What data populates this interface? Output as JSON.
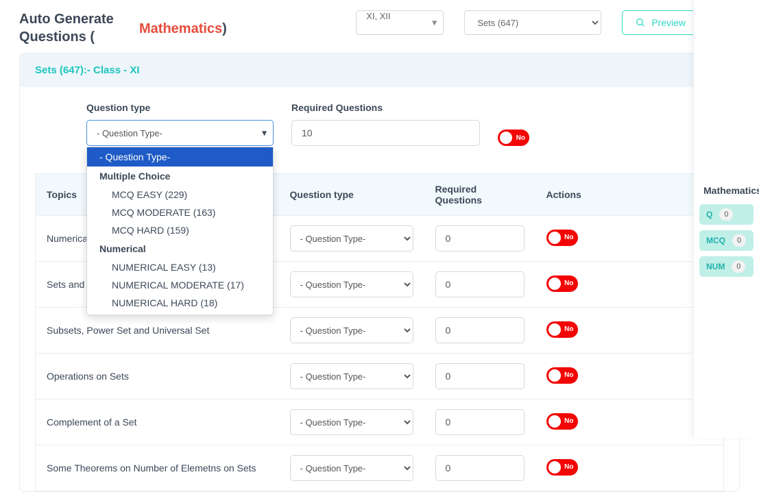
{
  "title": "Auto Generate Questions (",
  "subject": "Mathematics",
  "title_close": ")",
  "class_select": {
    "value": "XI, XII"
  },
  "chapter_select": {
    "value": "Sets (647)"
  },
  "preview_label": "Preview",
  "card": {
    "title": "Sets (647):- Class - XI"
  },
  "form": {
    "qtype_label": "Question type",
    "qtype_placeholder": "- Question Type-",
    "req_label": "Required Questions",
    "req_value": "10",
    "toggle_label": "No"
  },
  "dropdown": {
    "placeholder": "- Question Type-",
    "groups": [
      {
        "label": "Multiple Choice",
        "items": [
          "MCQ EASY (229)",
          "MCQ MODERATE (163)",
          "MCQ HARD (159)"
        ]
      },
      {
        "label": "Numerical",
        "items": [
          "NUMERICAL EASY (13)",
          "NUMERICAL MODERATE (17)",
          "NUMERICAL HARD (18)"
        ]
      }
    ]
  },
  "table": {
    "headers": {
      "topics": "Topics",
      "qtype": "Question type",
      "req": "Required Questions",
      "actions": "Actions"
    },
    "placeholder_select": "- Question Type-",
    "default_val": "0",
    "toggle_label": "No",
    "rows": [
      {
        "topic": "Numerica"
      },
      {
        "topic": "Sets and T"
      },
      {
        "topic": "Subsets, Power Set and Universal Set"
      },
      {
        "topic": "Operations on Sets"
      },
      {
        "topic": "Complement of a Set"
      },
      {
        "topic": "Some Theorems on Number of Elemetns on Sets"
      }
    ]
  },
  "sidebar": {
    "title": "Mathematics",
    "badges": [
      {
        "label": "Q",
        "count": "0"
      },
      {
        "label": "MCQ",
        "count": "0"
      },
      {
        "label": "NUM",
        "count": "0"
      }
    ]
  }
}
